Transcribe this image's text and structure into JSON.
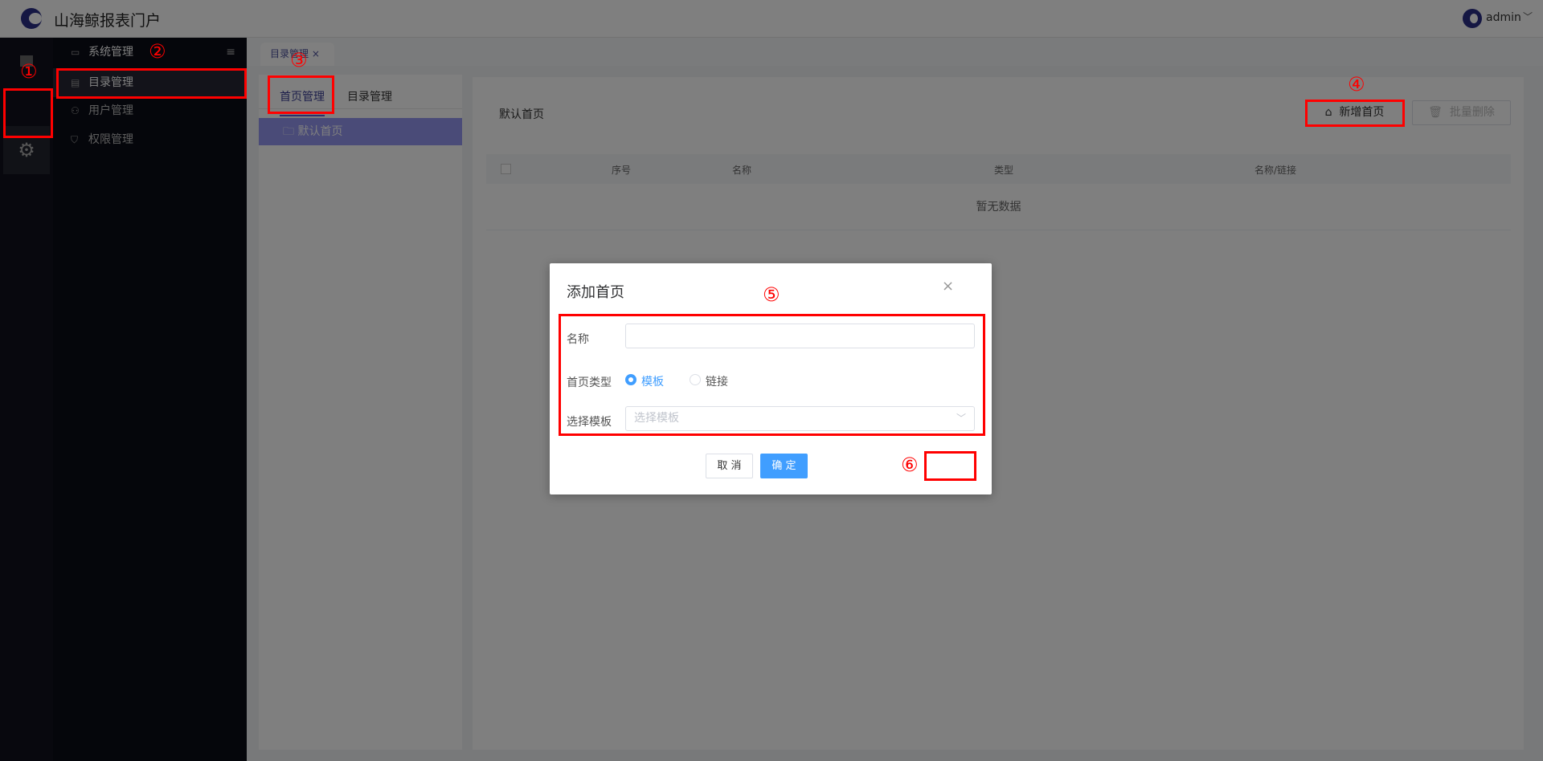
{
  "header": {
    "app_title": "山海鲸报表门户",
    "user": "admin",
    "user_chevron": "﹀"
  },
  "iconbar": {
    "settings_icon": "⚙"
  },
  "sidebar": {
    "section": "系统管理",
    "toggle": "≡",
    "items": [
      {
        "label": "目录管理",
        "icon": "▤"
      },
      {
        "label": "用户管理",
        "icon": "⚇"
      },
      {
        "label": "权限管理",
        "icon": "⛉"
      }
    ],
    "section_icon": "▭"
  },
  "tabbar": {
    "tab": "目录管理",
    "close": "×"
  },
  "left_panel": {
    "tabs": [
      "首页管理",
      "目录管理"
    ],
    "tree_item": "默认首页",
    "folder_icon": "🗀"
  },
  "right_panel": {
    "title": "默认首页",
    "add_button": "新增首页",
    "add_icon": "⌂",
    "delete_button": "批量删除",
    "delete_icon": "🗑",
    "columns": [
      "序号",
      "名称",
      "类型",
      "名称/链接"
    ],
    "empty_text": "暂无数据"
  },
  "modal": {
    "title": "添加首页",
    "close": "×",
    "name_label": "名称",
    "name_value": "",
    "type_label": "首页类型",
    "type_options": [
      "模板",
      "链接"
    ],
    "type_selected": "模板",
    "template_label": "选择模板",
    "template_placeholder": "选择模板",
    "select_chevron": "﹀",
    "cancel": "取 消",
    "confirm": "确 定"
  },
  "annotations": [
    "①",
    "②",
    "③",
    "④",
    "⑤",
    "⑥"
  ],
  "colors": {
    "primary": "#409eff",
    "annotation": "#ff0000",
    "sidebar_bg": "#0b0c16",
    "tree_selected": "#9496f0"
  }
}
